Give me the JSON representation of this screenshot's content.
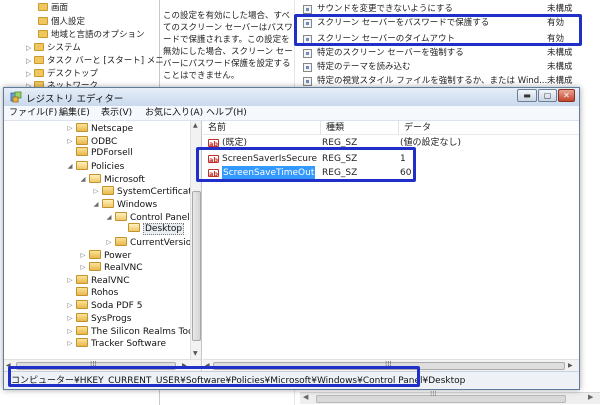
{
  "background": {
    "tree_items": [
      "画面",
      "個人設定",
      "地域と言語のオプション",
      "システム",
      "タスク バーと [スタート] メニ",
      "デスクトップ",
      "ネットワーク"
    ],
    "description_text": "この設定を有効にした場合、すべてのスクリーン セーバーはパスワードで保護されます。この設定を無効にした場合、スクリーン セーバーにパスワード保護を設定することはできません。",
    "policies": [
      {
        "name": "サウンドを変更できないようにする",
        "state": "未構成"
      },
      {
        "name": "スクリーン セーバーをパスワードで保護する",
        "state": "有効"
      },
      {
        "name": "スクリーン セーバーのタイムアウト",
        "state": "有効"
      },
      {
        "name": "特定のスクリーン セーバーを強制する",
        "state": "未構成"
      },
      {
        "name": "特定のテーマを読み込む",
        "state": "未構成"
      },
      {
        "name": "特定の視覚スタイル ファイルを強制するか、または Wind...",
        "state": "未構成"
      }
    ],
    "scroll_grip": "⁞⁞⁞"
  },
  "regedit": {
    "title": "レジストリ エディター",
    "window_buttons": {
      "minimize": "▬",
      "maximize": "▢",
      "close": "✕"
    },
    "menu": [
      "ファイル(F)",
      "編集(E)",
      "表示(V)",
      "お気に入り(A)",
      "ヘルプ(H)"
    ],
    "tree": [
      {
        "label": "Netscape",
        "expander": "▷"
      },
      {
        "label": "ODBC",
        "expander": "▷"
      },
      {
        "label": "PDForsell",
        "expander": ""
      },
      {
        "label": "Policies",
        "expander": "◢"
      },
      {
        "label": "Microsoft",
        "expander": "◢"
      },
      {
        "label": "SystemCertificates",
        "expander": "▷"
      },
      {
        "label": "Windows",
        "expander": "◢"
      },
      {
        "label": "Control Panel",
        "expander": "◢"
      },
      {
        "label": "Desktop",
        "expander": ""
      },
      {
        "label": "CurrentVersion",
        "expander": "▷"
      },
      {
        "label": "Power",
        "expander": "▷"
      },
      {
        "label": "RealVNC",
        "expander": "▷"
      },
      {
        "label": "RealVNC",
        "expander": "▷"
      },
      {
        "label": "Rohos",
        "expander": ""
      },
      {
        "label": "Soda PDF 5",
        "expander": "▷"
      },
      {
        "label": "SysProgs",
        "expander": "▷"
      },
      {
        "label": "The Silicon Realms Toolw",
        "expander": "▷"
      },
      {
        "label": "Tracker Software",
        "expander": "▷"
      }
    ],
    "columns": {
      "name": "名前",
      "type": "種類",
      "data": "データ"
    },
    "values": [
      {
        "name": "(既定)",
        "type": "REG_SZ",
        "data": "(値の設定なし)"
      },
      {
        "name": "ScreenSaverIsSecure",
        "type": "REG_SZ",
        "data": "1"
      },
      {
        "name": "ScreenSaveTimeOut",
        "type": "REG_SZ",
        "data": "60"
      }
    ],
    "value_icon": "ab",
    "status_path": "コンピューター¥HKEY_CURRENT_USER¥Software¥Policies¥Microsoft¥Windows¥Control Panel¥Desktop",
    "scroll_grip": "⁞⁞⁞"
  },
  "colors": {
    "highlight": "#1f2fc8",
    "selection": "#3399ff",
    "titlebar": "#c9d9ec"
  }
}
